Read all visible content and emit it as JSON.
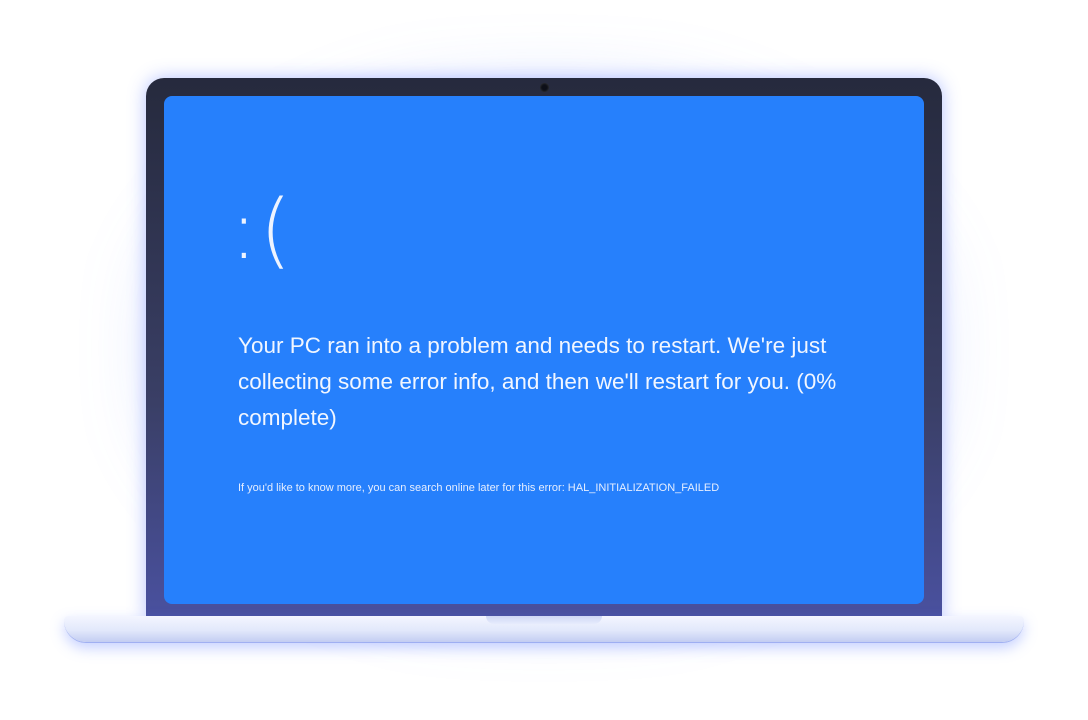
{
  "screen": {
    "sad_face": ":(",
    "message": "Your PC ran into a problem and needs to restart. We're just collecting some error info, and then we'll restart for you. (0% complete)",
    "info_text": "If you'd like to know more, you can search online later for this error: HAL_INITIALIZATION_FAILED"
  },
  "colors": {
    "screen_background": "#2680fc",
    "bezel": "#262a3d",
    "text": "#f1f6ff"
  }
}
